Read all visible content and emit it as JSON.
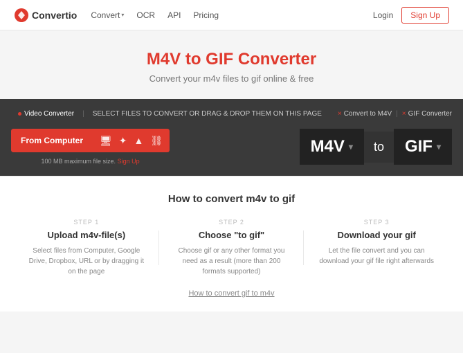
{
  "header": {
    "logo_text": "Convertio",
    "nav": [
      {
        "label": "Convert",
        "has_chevron": true
      },
      {
        "label": "OCR",
        "has_chevron": false
      },
      {
        "label": "API",
        "has_chevron": false
      },
      {
        "label": "Pricing",
        "has_chevron": false
      }
    ],
    "login_label": "Login",
    "signup_label": "Sign Up"
  },
  "hero": {
    "title": "M4V to GIF Converter",
    "subtitle": "Convert your m4v files to gif online & free"
  },
  "converter": {
    "tabs": [
      {
        "label": "Video Converter",
        "active": true,
        "dot": true
      },
      {
        "label": "SELECT FILES TO CONVERT OR DRAG & DROP THEM ON THIS PAGE",
        "active": false
      }
    ],
    "tab_right": [
      {
        "label": "Convert to M4V"
      },
      {
        "label": "GIF Converter"
      }
    ],
    "upload_button": "From Computer",
    "file_size_note": "100 MB maximum file size.",
    "signup_link": "Sign Up",
    "format_from": "M4V",
    "format_to_label": "to",
    "format_to": "GIF"
  },
  "how_to": {
    "title": "How to convert m4v to gif",
    "steps": [
      {
        "step_label": "STEP 1",
        "step_title": "Upload m4v-file(s)",
        "step_desc": "Select files from Computer, Google Drive, Dropbox, URL or by dragging it on the page"
      },
      {
        "step_label": "STEP 2",
        "step_title": "Choose \"to gif\"",
        "step_desc": "Choose gif or any other format you need as a result (more than 200 formats supported)"
      },
      {
        "step_label": "STEP 3",
        "step_title": "Download your gif",
        "step_desc": "Let the file convert and you can download your gif file right afterwards"
      }
    ],
    "convert_link": "How to convert gif to m4v"
  }
}
